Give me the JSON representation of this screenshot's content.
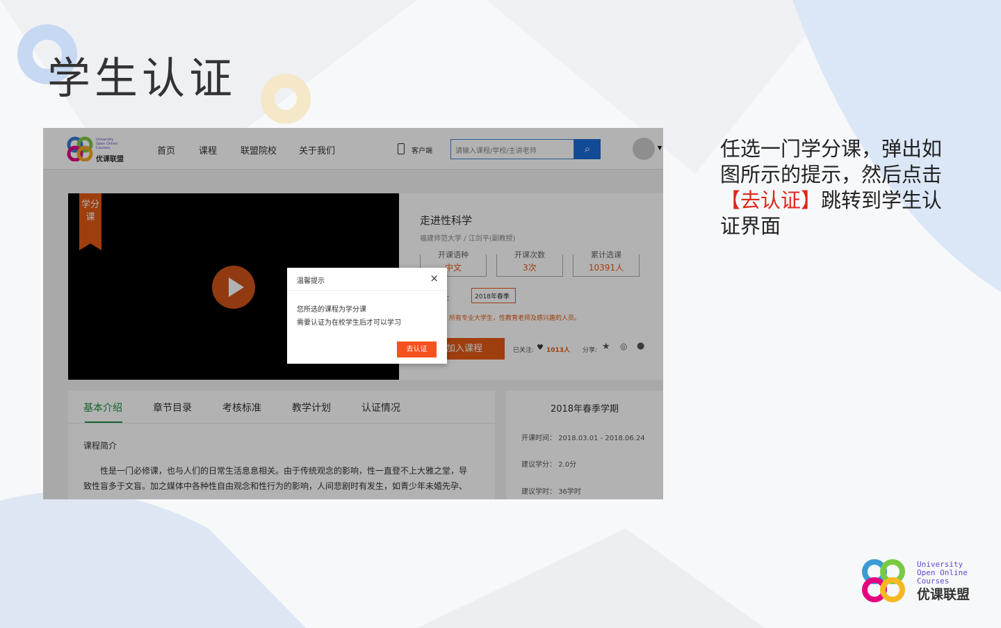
{
  "slide": {
    "title": "学生认证",
    "instruction_before": "任选一门学分课，弹出如图所示的提示，然后点击",
    "instruction_highlight": "【去认证】",
    "instruction_after": "跳转到学生认证界面",
    "logo": {
      "line1": "University",
      "line2": "Open Online",
      "line3": "Courses",
      "cn": "优课联盟"
    }
  },
  "site": {
    "logo": {
      "en": "University Open Online Courses",
      "cn": "优课联盟"
    },
    "nav": [
      "首页",
      "课程",
      "联盟院校",
      "关于我们"
    ],
    "client": "客户端",
    "search_placeholder": "请输入课程/学校/主讲老师",
    "course": {
      "badge": "学分课",
      "title": "走进性科学",
      "school": "福建师范大学 / 江剑平(副教授)",
      "stats": [
        {
          "label": "开课语种",
          "value": "中文"
        },
        {
          "label": "开课次数",
          "value": "3次"
        },
        {
          "label": "累计选课",
          "value": "10391人"
        }
      ],
      "term_label": "期：",
      "term": "2018年春季",
      "audience": "所有专业大学生，性教育老师及感兴趣的人员。",
      "join": "加入课程",
      "follow_label": "已关注:",
      "follow_count": "1013人",
      "share_label": "分享:"
    },
    "tabs": [
      "基本介绍",
      "章节目录",
      "考核标准",
      "教学计划",
      "认证情况"
    ],
    "intro_heading": "课程简介",
    "intro_lines": [
      "性是一门必修课，也与人们的日常生活息息相关。由于传统观念的影响，性一直登不上大雅之堂，导",
      "致性盲多于文盲。加之媒体中各种性自由观念和性行为的影响，人间悲剧时有发生，如青少年未婚先孕、"
    ],
    "semester": {
      "title": "2018年春季学期",
      "rows": [
        {
          "label": "开课时间：",
          "value": "2018.03.01 - 2018.06.24"
        },
        {
          "label": "建议学分：",
          "value": "2.0分"
        },
        {
          "label": "建议学时：",
          "value": "36学时"
        }
      ]
    },
    "dialog": {
      "title": "温馨提示",
      "line1": "您所选的课程为学分课",
      "line2": "需要认证为在校学生后才可以学习",
      "button": "去认证",
      "close": "×"
    }
  }
}
